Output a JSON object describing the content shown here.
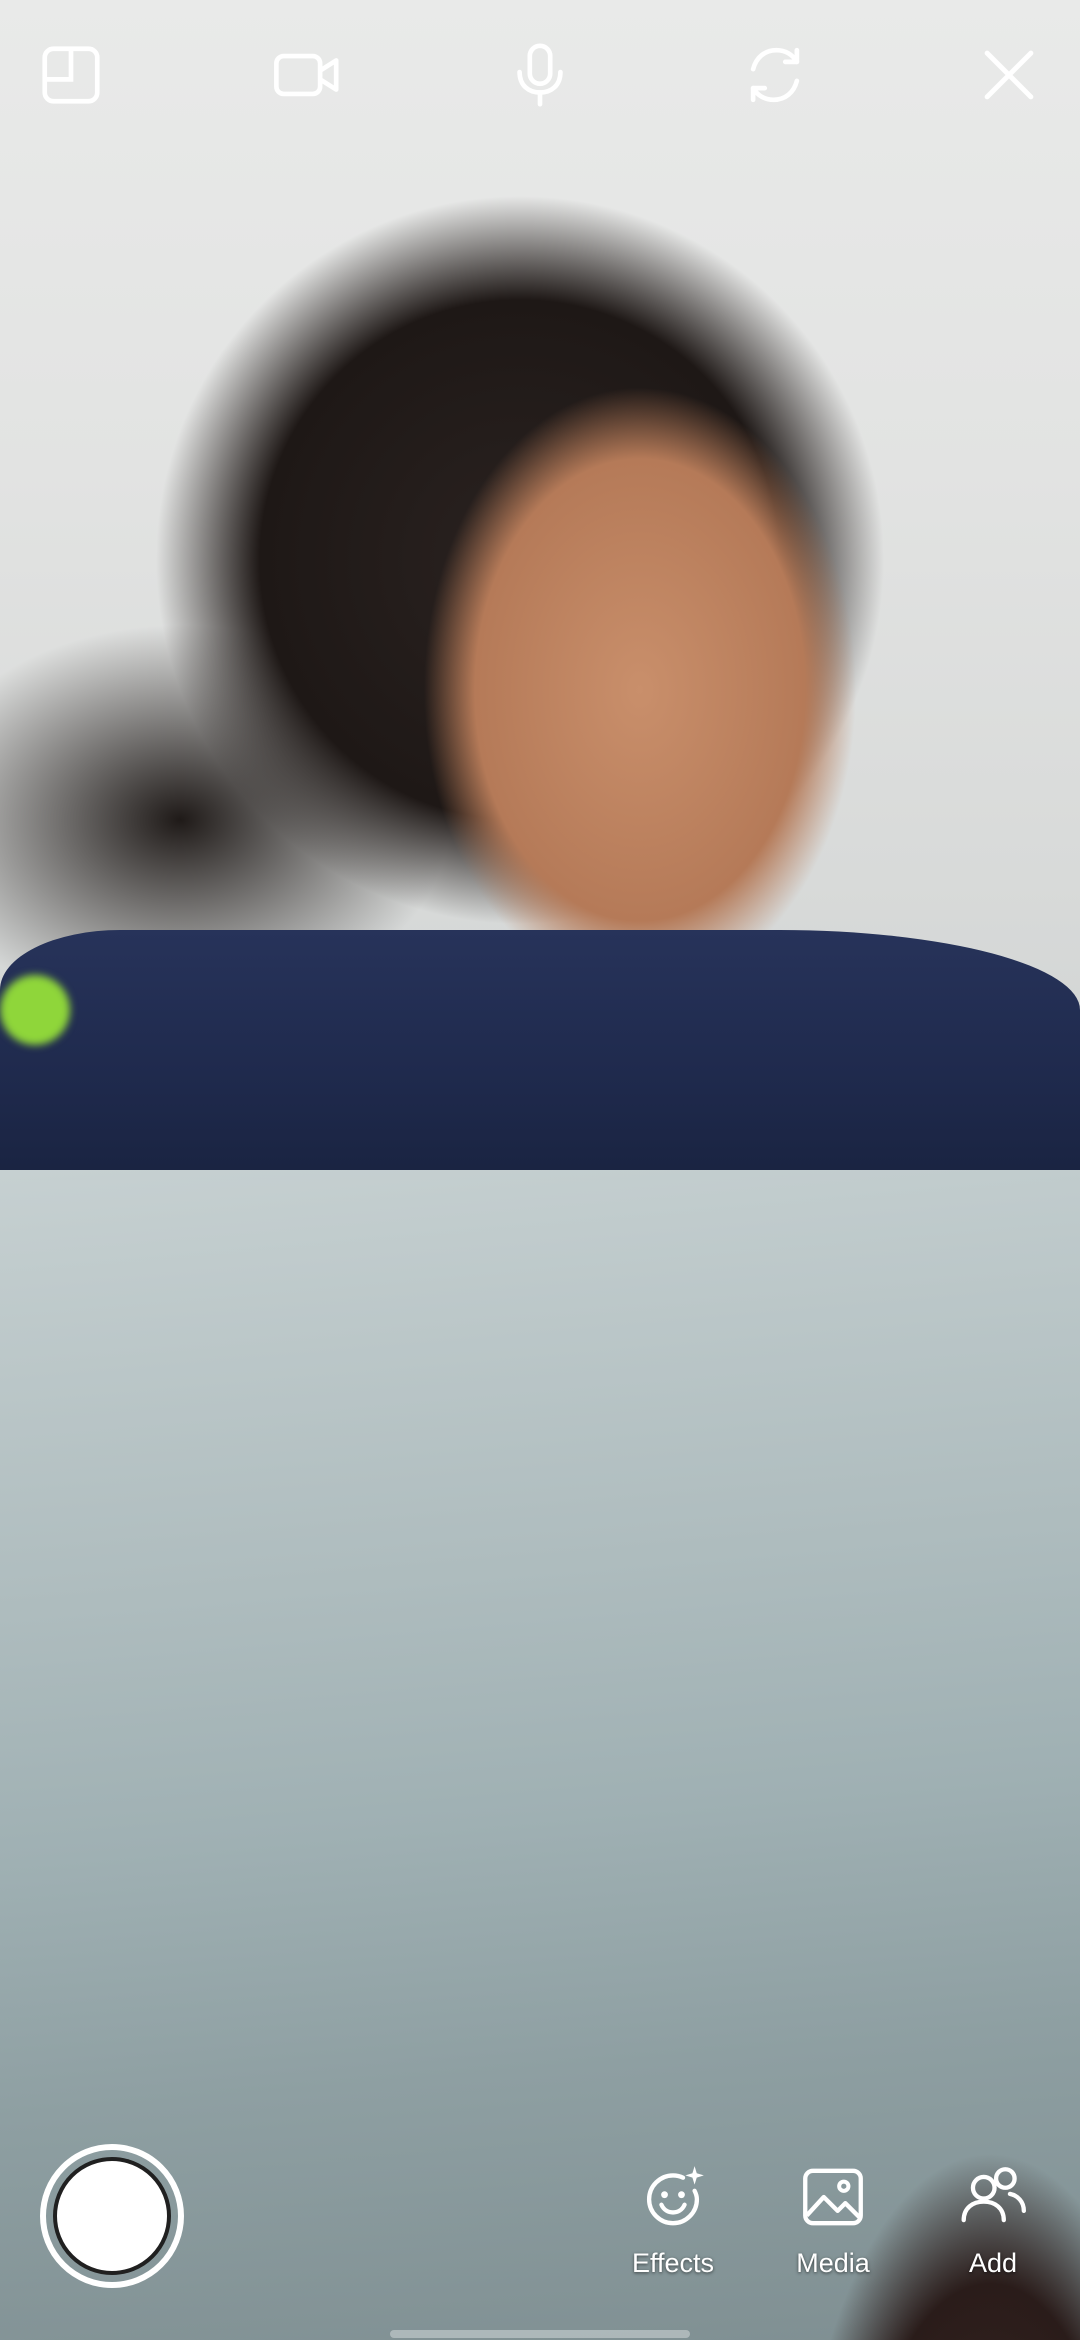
{
  "video_tiles": {
    "remote": {
      "label": ""
    },
    "self": {
      "label": ""
    }
  },
  "top_controls": [
    {
      "name": "layout-icon",
      "label": ""
    },
    {
      "name": "video-camera-icon",
      "label": ""
    },
    {
      "name": "microphone-icon",
      "label": ""
    },
    {
      "name": "flip-camera-icon",
      "label": ""
    },
    {
      "name": "close-icon",
      "label": ""
    }
  ],
  "bottom_controls": {
    "effects_label": "Effects",
    "media_label": "Media",
    "add_label": "Add"
  },
  "colors": {
    "icon": "#ffffff",
    "blanket": "#1f2a4d"
  }
}
